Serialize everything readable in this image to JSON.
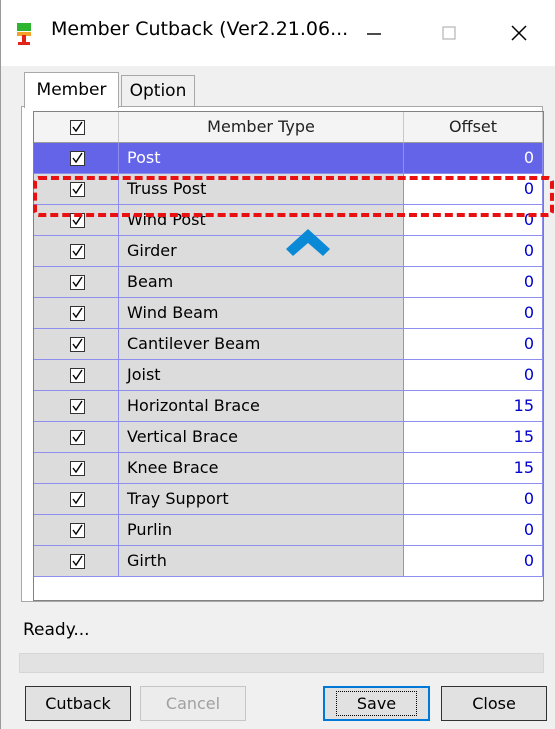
{
  "window": {
    "title": "Member Cutback (Ver2.21.06...",
    "minimize_glyph": "—",
    "maximize_glyph": "☐",
    "close_glyph": "✕"
  },
  "tabs": [
    {
      "label": "Member",
      "active": true
    },
    {
      "label": "Option",
      "active": false
    }
  ],
  "grid": {
    "headers": {
      "check": "☑",
      "type": "Member Type",
      "offset": "Offset"
    },
    "rows": [
      {
        "type": "Post",
        "offset": "0",
        "checked": true,
        "selected": true
      },
      {
        "type": "Truss Post",
        "offset": "0",
        "checked": true,
        "selected": false
      },
      {
        "type": "Wind Post",
        "offset": "0",
        "checked": true,
        "selected": false
      },
      {
        "type": "Girder",
        "offset": "0",
        "checked": true,
        "selected": false
      },
      {
        "type": "Beam",
        "offset": "0",
        "checked": true,
        "selected": false
      },
      {
        "type": "Wind Beam",
        "offset": "0",
        "checked": true,
        "selected": false
      },
      {
        "type": "Cantilever Beam",
        "offset": "0",
        "checked": true,
        "selected": false
      },
      {
        "type": "Joist",
        "offset": "0",
        "checked": true,
        "selected": false
      },
      {
        "type": "Horizontal Brace",
        "offset": "15",
        "checked": true,
        "selected": false
      },
      {
        "type": "Vertical Brace",
        "offset": "15",
        "checked": true,
        "selected": false
      },
      {
        "type": "Knee Brace",
        "offset": "15",
        "checked": true,
        "selected": false
      },
      {
        "type": "Tray Support",
        "offset": "0",
        "checked": true,
        "selected": false
      },
      {
        "type": "Purlin",
        "offset": "0",
        "checked": true,
        "selected": false
      },
      {
        "type": "Girth",
        "offset": "0",
        "checked": true,
        "selected": false
      }
    ]
  },
  "annotation": {
    "highlight_color": "#e81010",
    "arrow_color": "#0a8ad6"
  },
  "status": {
    "text": "Ready...",
    "progress": 0
  },
  "buttons": {
    "cutback": "Cutback",
    "cancel": "Cancel",
    "save": "Save",
    "close": "Close"
  },
  "colors": {
    "selected_row": "#6464e8",
    "offset_text": "#0000cc",
    "grid_lines": "#8e8eef"
  }
}
